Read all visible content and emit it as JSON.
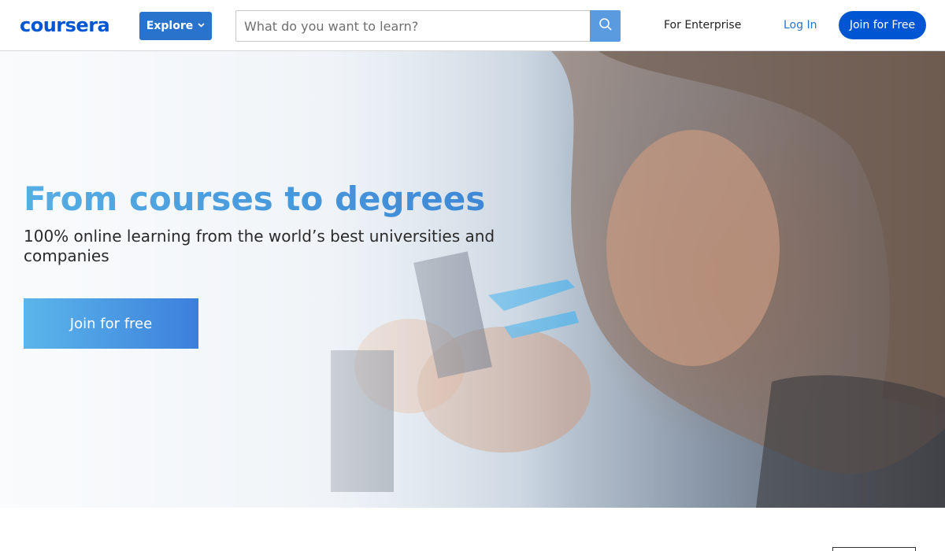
{
  "header": {
    "logo_text": "coursera",
    "explore_label": "Explore",
    "search_placeholder": "What do you want to learn?",
    "enterprise_label": "For Enterprise",
    "login_label": "Log In",
    "join_label": "Join for Free"
  },
  "hero": {
    "title": "From courses to degrees",
    "subtitle": "100% online learning from the world’s best universities and companies",
    "cta_label": "Join for free"
  },
  "colors": {
    "brand": "#0056d2",
    "explore": "#2a73cc",
    "search_button": "#5a9be0"
  },
  "icons": {
    "search": "search-icon",
    "explore_chevron": "chevron-down-icon"
  }
}
